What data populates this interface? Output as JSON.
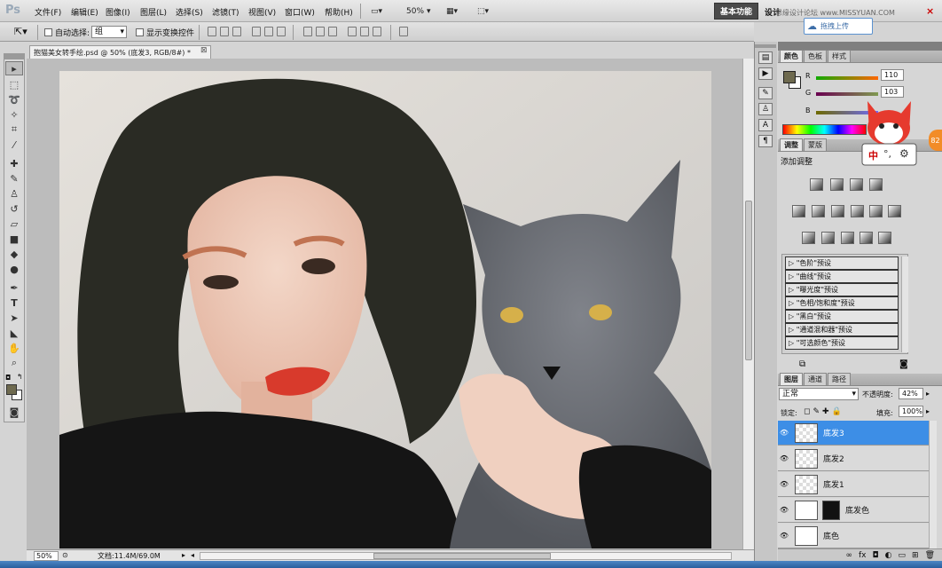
{
  "app": {
    "logo": "Ps"
  },
  "menus": [
    "文件(F)",
    "编辑(E)",
    "图像(I)",
    "图层(L)",
    "选择(S)",
    "滤镜(T)",
    "视图(V)",
    "窗口(W)",
    "帮助(H)"
  ],
  "menubar": {
    "zoom": "50%",
    "ws_basic": "基本功能",
    "ws_design": "设计",
    "watermark": "思缘设计论坛 www.MISSYUAN.COM"
  },
  "cloud": {
    "label": "拖拽上传"
  },
  "options": {
    "auto_select_label": "自动选择:",
    "auto_select_value": "组",
    "show_transform_label": "显示变换控件"
  },
  "document": {
    "tab_title": "抱猫美女转手绘.psd @ 50% (底发3, RGB/8#) *"
  },
  "status": {
    "zoom": "50%",
    "doc_size": "文档:11.4M/69.0M"
  },
  "color_panel": {
    "tabs": [
      "颜色",
      "色板",
      "样式"
    ],
    "channels": [
      {
        "label": "R",
        "value": "110"
      },
      {
        "label": "G",
        "value": "103"
      },
      {
        "label": "B",
        "value": ""
      }
    ],
    "foreground": "#6e6a4f"
  },
  "adjust_panel": {
    "tabs": [
      "调整",
      "蒙版"
    ],
    "title": "添加调整",
    "presets": [
      "\"色阶\"预设",
      "\"曲线\"预设",
      "\"曝光度\"预设",
      "\"色相/饱和度\"预设",
      "\"黑白\"预设",
      "\"通道混和器\"预设",
      "\"可选颜色\"预设"
    ]
  },
  "layers_panel": {
    "tabs": [
      "图层",
      "通道",
      "路径"
    ],
    "blend_mode": "正常",
    "opacity_label": "不透明度:",
    "opacity": "42%",
    "lock_label": "锁定:",
    "fill_label": "填充:",
    "fill": "100%",
    "layers": [
      {
        "name": "底发3",
        "selected": true
      },
      {
        "name": "底发2",
        "selected": false
      },
      {
        "name": "底发1",
        "selected": false
      },
      {
        "name": "底发色",
        "selected": false
      },
      {
        "name": "底色",
        "selected": false
      }
    ]
  },
  "ime": {
    "label": "中"
  },
  "orange_tab": {
    "label": "82"
  },
  "colors": {
    "accent": "#3d8ee6",
    "lips": "#d83a2c",
    "hair": "#2a2b24",
    "cat": "#6d7077"
  }
}
